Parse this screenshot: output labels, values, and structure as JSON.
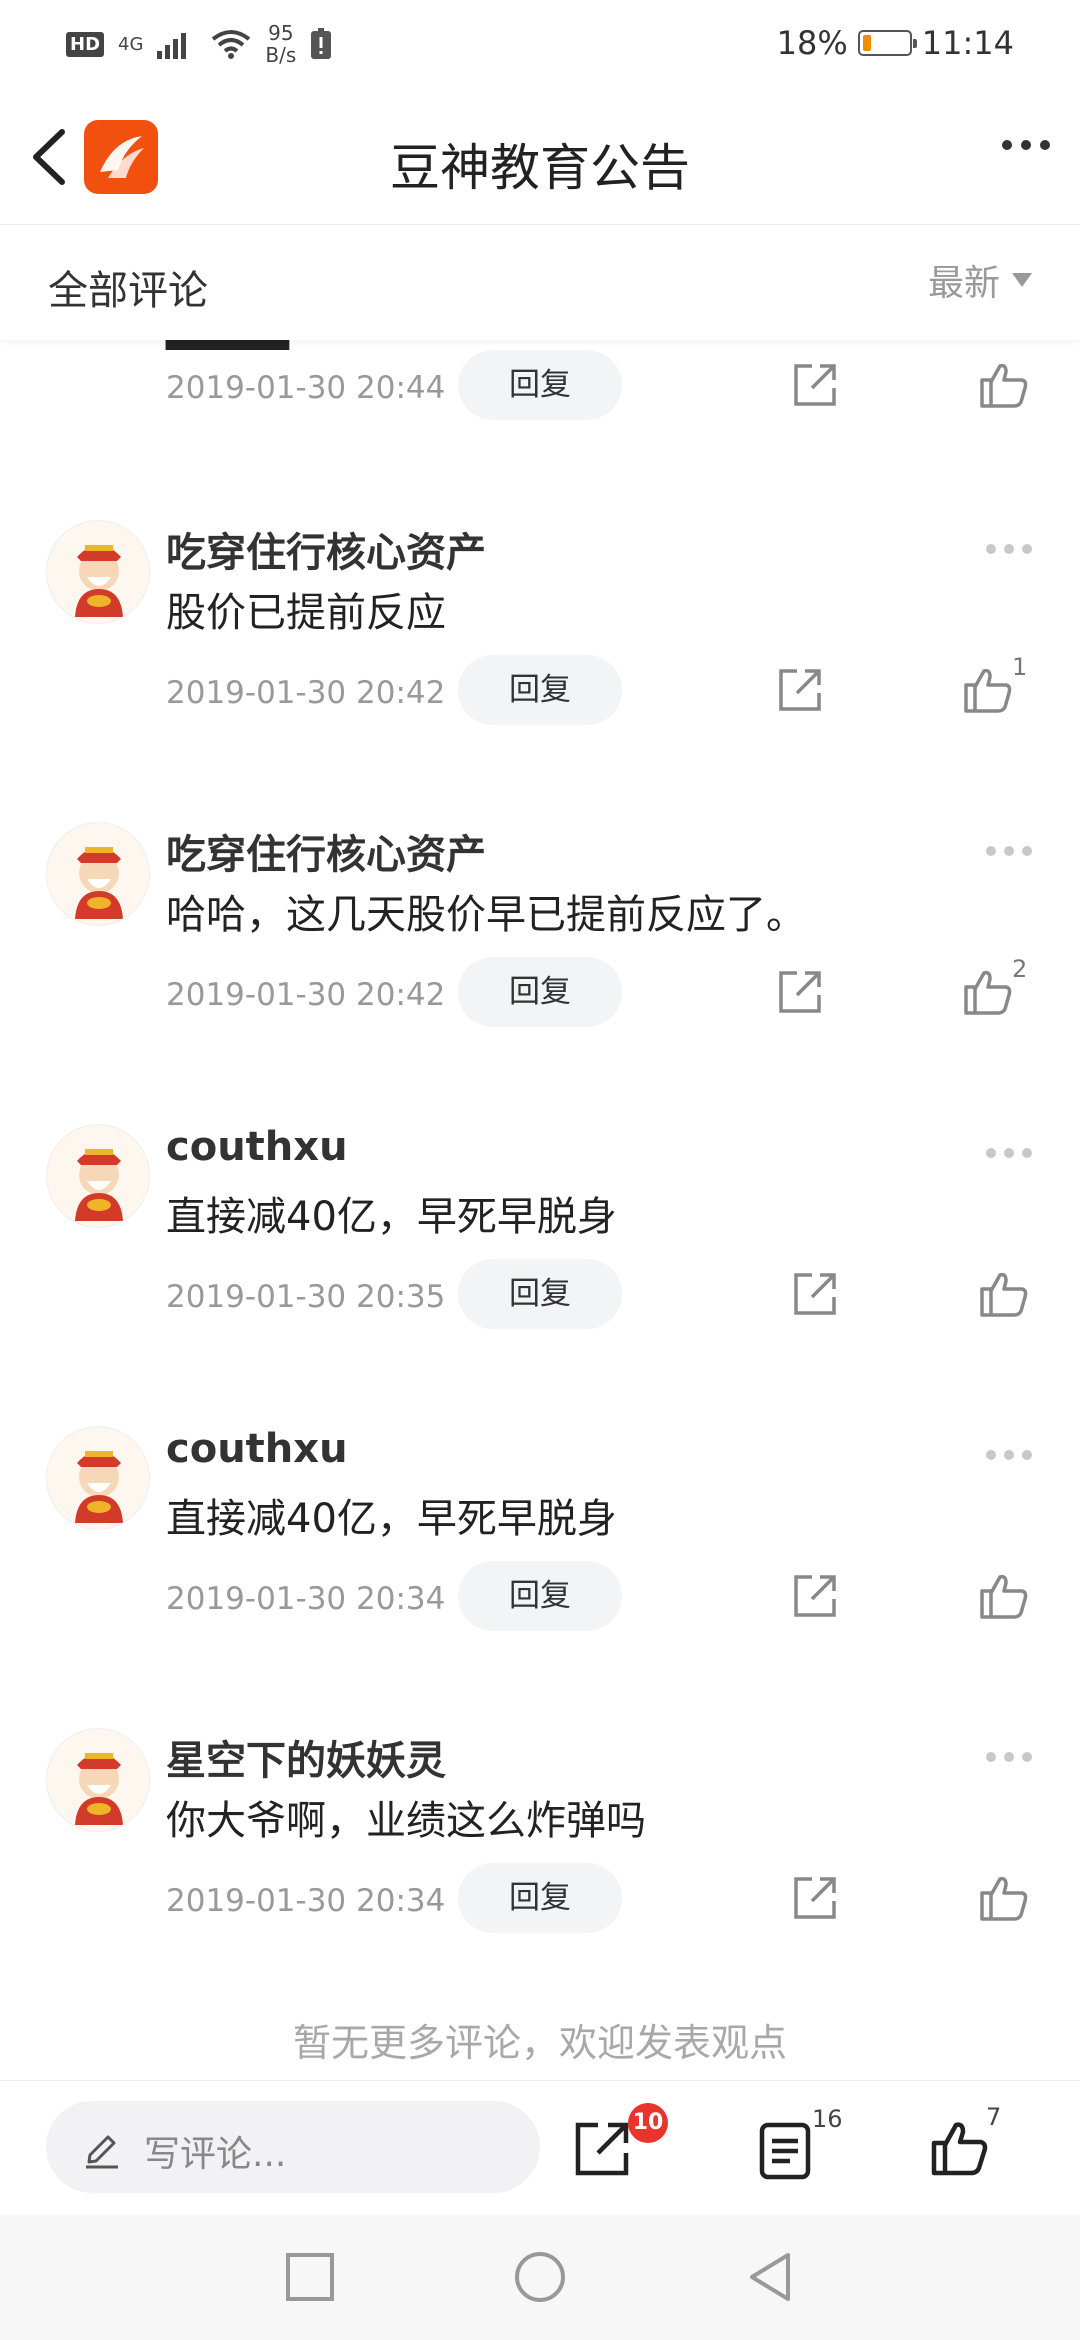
{
  "status_bar": {
    "hd": "HD",
    "network": "4G",
    "speed_value": "95",
    "speed_unit": "B/s",
    "battery_percent": "18%",
    "battery_level": 0.18,
    "time": "11:14"
  },
  "title_bar": {
    "title": "豆神教育公告",
    "logo_color": "#f2500f"
  },
  "comments_header": {
    "title": "全部评论",
    "sort_label": "最新"
  },
  "partial_comment": {
    "time": "2019-01-30 20:44",
    "reply_label": "回复"
  },
  "comments": [
    {
      "name": "吃穿住行核心资产",
      "text": "股价已提前反应",
      "time": "2019-01-30 20:42",
      "reply_label": "回复",
      "likes": "1"
    },
    {
      "name": "吃穿住行核心资产",
      "text": "哈哈，这几天股价早已提前反应了。",
      "time": "2019-01-30 20:42",
      "reply_label": "回复",
      "likes": "2"
    },
    {
      "name": "couthxu",
      "text": "直接减40亿，早死早脱身",
      "time": "2019-01-30 20:35",
      "reply_label": "回复",
      "likes": ""
    },
    {
      "name": "couthxu",
      "text": "直接减40亿，早死早脱身",
      "time": "2019-01-30 20:34",
      "reply_label": "回复",
      "likes": ""
    },
    {
      "name": "星空下的妖妖灵",
      "text": "你大爷啊，业绩这么炸弹吗",
      "time": "2019-01-30 20:34",
      "reply_label": "回复",
      "likes": ""
    }
  ],
  "end_note": "暂无更多评论，欢迎发表观点",
  "bottom_bar": {
    "input_placeholder": "写评论...",
    "share_badge": "10",
    "comment_count": "16",
    "like_count": "7"
  },
  "colors": {
    "accent": "#f2500f",
    "badge": "#e8342c",
    "muted_text": "#999999"
  }
}
